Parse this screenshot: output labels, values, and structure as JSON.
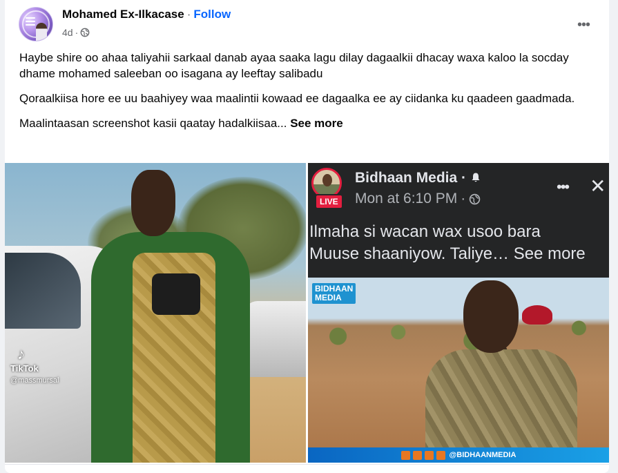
{
  "post": {
    "author": "Mohamed Ex-Ilkacase",
    "separator": "·",
    "follow_label": "Follow",
    "time": "4d",
    "time_separator": "·",
    "audience_icon": "globe-icon",
    "more_icon": "more-horizontal-icon",
    "paragraphs": [
      "Haybe shire  oo  ahaa taliyahii sarkaal danab ayaa saaka lagu dilay dagaalkii dhacay waxa kaloo la socday dhame mohamed saleeban oo isagana ay leeftay salibadu",
      "Qoraalkiisa hore ee uu baahiyey waa maalintii kowaad ee dagaalka ee ay ciidanka ku qaadeen gaadmada."
    ],
    "last_paragraph": "Maalintaasan screenshot kasii qaatay hadalkiisaa...",
    "see_more_label": "See more"
  },
  "photo_left": {
    "tiktok_label": "TikTok",
    "tiktok_handle": "@massmursal"
  },
  "photo_right": {
    "page_name": "Bidhaan Media",
    "name_separator": "·",
    "bell_icon": "bell-icon",
    "live_badge": "LIVE",
    "time": "Mon at 6:10 PM",
    "time_separator": "·",
    "audience_icon": "globe-icon",
    "more_icon": "more-horizontal-icon",
    "close_icon": "close-icon",
    "caption_line1": "Ilmaha si wacan wax usoo bara",
    "caption_line2": "Muuse shaaniyow.  Taliye…",
    "caption_see_more": "See more",
    "video_logo_line1": "BIDHAAN",
    "video_logo_line2": "MEDIA",
    "video_handle": "@BIDHAANMEDIA"
  },
  "colors": {
    "accent_blue": "#0866ff",
    "live_red": "#e41e3f",
    "text_secondary": "#65676b"
  }
}
